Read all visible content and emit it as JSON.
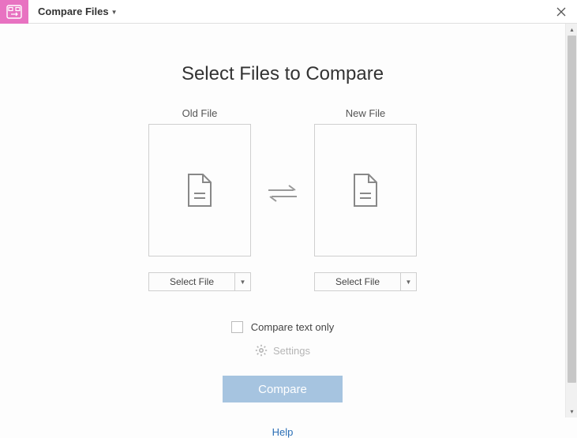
{
  "titlebar": {
    "app_title": "Compare Files"
  },
  "main": {
    "heading": "Select Files to Compare",
    "old_file_label": "Old File",
    "new_file_label": "New File",
    "select_file_button": "Select File"
  },
  "options": {
    "compare_text_only_label": "Compare text only",
    "compare_text_only_checked": false,
    "settings_label": "Settings",
    "compare_button": "Compare",
    "help_link": "Help"
  },
  "icons": {
    "app": "compare-app-icon",
    "close": "close-icon",
    "document": "document-icon",
    "swap": "swap-arrows-icon",
    "gear": "gear-icon",
    "caret_down": "caret-down-icon",
    "scroll_up": "scroll-up-icon",
    "scroll_down": "scroll-down-icon"
  },
  "colors": {
    "accent_pink": "#e872c1",
    "button_blue": "#a6c4e0",
    "link_blue": "#2b6fb6"
  }
}
